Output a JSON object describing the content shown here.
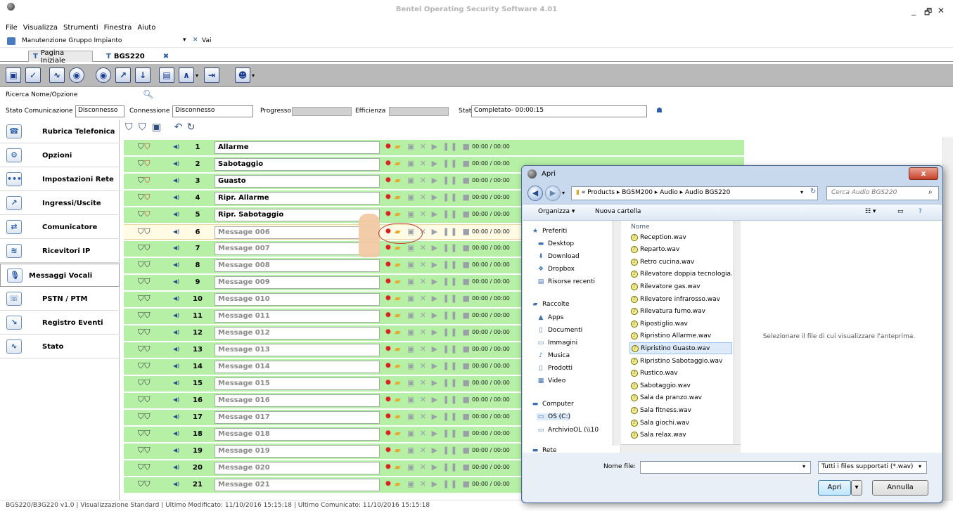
{
  "app": {
    "title": "Bentel Operating Security Software 4.01",
    "window_controls": {
      "minimize": "_",
      "restore": "🗗",
      "close": "✕"
    },
    "menu": [
      "File",
      "Visualizza",
      "Strumenti",
      "Finestra",
      "Aiuto"
    ],
    "address": {
      "label": "Manutenzione Gruppo Impianto",
      "go": "Vai"
    },
    "tabs": [
      {
        "label": "Pagina Iniziale"
      },
      {
        "label": "BGS220"
      }
    ],
    "search_label": "Ricerca Nome/Opzione",
    "status": {
      "comm_label": "Stato Comunicazione",
      "comm_value": "Disconnesso",
      "conn_label": "Connessione",
      "conn_value": "Disconnesso",
      "progress_label": "Progresso",
      "efficiency_label": "Efficienza",
      "state_label": "Stato",
      "state_value": "Completato- 00:00:15"
    }
  },
  "sidebar": [
    {
      "label": "Rubrica Telefonica",
      "icon": "phonebook-icon",
      "glyph": "☎"
    },
    {
      "label": "Opzioni",
      "icon": "gears-icon",
      "glyph": "⚙"
    },
    {
      "label": "Impostazioni Rete",
      "icon": "network-dots-icon",
      "glyph": "•••"
    },
    {
      "label": "Ingressi/Uscite",
      "icon": "io-arrow-icon",
      "glyph": "↗"
    },
    {
      "label": "Comunicatore",
      "icon": "communicator-icon",
      "glyph": "⇄"
    },
    {
      "label": "Ricevitori IP",
      "icon": "wifi-icon",
      "glyph": "≋"
    },
    {
      "label": "Messaggi Vocali",
      "icon": "microphone-icon",
      "glyph": "🎙"
    },
    {
      "label": "PSTN / PTM",
      "icon": "pstn-icon",
      "glyph": "☏"
    },
    {
      "label": "Registro Eventi",
      "icon": "event-log-icon",
      "glyph": "↘"
    },
    {
      "label": "Stato",
      "icon": "status-pulse-icon",
      "glyph": "∿"
    }
  ],
  "messages": [
    {
      "num": "1",
      "name": "Allarme",
      "recorded": true,
      "time": "00:00 / 00:00"
    },
    {
      "num": "2",
      "name": "Sabotaggio",
      "recorded": true,
      "time": "00:00 / 00:00"
    },
    {
      "num": "3",
      "name": "Guasto",
      "recorded": true,
      "time": "00:00 / 00:00"
    },
    {
      "num": "4",
      "name": "Ripr. Allarme",
      "recorded": true,
      "time": "00:00 / 00:00"
    },
    {
      "num": "5",
      "name": "Ripr. Sabotaggio",
      "recorded": true,
      "time": "00:00 / 00:00"
    },
    {
      "num": "6",
      "name": "Message 006",
      "recorded": false,
      "time": "00:00 / 00:00"
    },
    {
      "num": "7",
      "name": "Message 007",
      "recorded": false,
      "time": "00:00 / 00:00"
    },
    {
      "num": "8",
      "name": "Message 008",
      "recorded": false,
      "time": "00:00 / 00:00"
    },
    {
      "num": "9",
      "name": "Message 009",
      "recorded": false,
      "time": "00:00 / 00:00"
    },
    {
      "num": "10",
      "name": "Message 010",
      "recorded": false,
      "time": "00:00 / 00:00"
    },
    {
      "num": "11",
      "name": "Message 011",
      "recorded": false,
      "time": "00:00 / 00:00"
    },
    {
      "num": "12",
      "name": "Message 012",
      "recorded": false,
      "time": "00:00 / 00:00"
    },
    {
      "num": "13",
      "name": "Message 013",
      "recorded": false,
      "time": "00:00 / 00:00"
    },
    {
      "num": "14",
      "name": "Message 014",
      "recorded": false,
      "time": "00:00 / 00:00"
    },
    {
      "num": "15",
      "name": "Message 015",
      "recorded": false,
      "time": "00:00 / 00:00"
    },
    {
      "num": "16",
      "name": "Message 016",
      "recorded": false,
      "time": "00:00 / 00:00"
    },
    {
      "num": "17",
      "name": "Message 017",
      "recorded": false,
      "time": "00:00 / 00:00"
    },
    {
      "num": "18",
      "name": "Message 018",
      "recorded": false,
      "time": "00:00 / 00:00"
    },
    {
      "num": "19",
      "name": "Message 019",
      "recorded": false,
      "time": "00:00 / 00:00"
    },
    {
      "num": "20",
      "name": "Message 020",
      "recorded": false,
      "time": "00:00 / 00:00"
    },
    {
      "num": "21",
      "name": "Message 021",
      "recorded": false,
      "time": "00:00 / 00:00"
    }
  ],
  "selected_row": "6",
  "footer": "BGS220/B3G220 v1.0  |  Visualizzazione Standard  |  Ultimo Modificato: 11/10/2016 15:15:18  |  Ultimo Comunicato: 11/10/2016 15:15:18",
  "dialog": {
    "title": "Apri",
    "close": "x",
    "path": "« Products ▸ BGSM200 ▸ Audio ▸ Audio BGS220",
    "search_placeholder": "Cerca Audio BGS220",
    "organize": "Organizza ▾",
    "new_folder": "Nuova cartella",
    "tree": [
      {
        "label": "Preferiti",
        "icon": "star-icon",
        "glyph": "★"
      },
      {
        "label": "Desktop",
        "icon": "desktop-icon",
        "glyph": "▬"
      },
      {
        "label": "Download",
        "icon": "download-folder-icon",
        "glyph": "⬇"
      },
      {
        "label": "Dropbox",
        "icon": "dropbox-icon",
        "glyph": "❖"
      },
      {
        "label": "Risorse recenti",
        "icon": "recent-icon",
        "glyph": "▤"
      },
      {
        "label": "Raccolte",
        "icon": "libraries-icon",
        "glyph": "▰"
      },
      {
        "label": "Apps",
        "icon": "apps-icon",
        "glyph": "▲"
      },
      {
        "label": "Documenti",
        "icon": "documents-icon",
        "glyph": "▯"
      },
      {
        "label": "Immagini",
        "icon": "pictures-icon",
        "glyph": "▭"
      },
      {
        "label": "Musica",
        "icon": "music-icon",
        "glyph": "♪"
      },
      {
        "label": "Prodotti",
        "icon": "products-icon",
        "glyph": "▯"
      },
      {
        "label": "Video",
        "icon": "video-icon",
        "glyph": "▦"
      },
      {
        "label": "Computer",
        "icon": "computer-icon",
        "glyph": "▬"
      },
      {
        "label": "OS (C:)",
        "icon": "drive-icon",
        "glyph": "▭"
      },
      {
        "label": "ArchivioOL (\\\\10",
        "icon": "network-drive-icon",
        "glyph": "▭"
      },
      {
        "label": "Rete",
        "icon": "network-icon",
        "glyph": "▬"
      }
    ],
    "column_header": "Nome",
    "files": [
      "Reception.wav",
      "Reparto.wav",
      "Retro cucina.wav",
      "Rilevatore doppia tecnologia.wav",
      "Rilevatore gas.wav",
      "Rilevatore infrarosso.wav",
      "Rilevatura fumo.wav",
      "Ripostiglio.wav",
      "Ripristino Allarme.wav",
      "Ripristino Guasto.wav",
      "Ripristino Sabotaggio.wav",
      "Rustico.wav",
      "Sabotaggio.wav",
      "Sala da pranzo.wav",
      "Sala fitness.wav",
      "Sala giochi.wav",
      "Sala relax.wav"
    ],
    "highlighted_file": "Ripristino Guasto.wav",
    "preview_text": "Selezionare il file di cui visualizzare l'anteprima.",
    "filename_label": "Nome file:",
    "filename_value": "",
    "filter": "Tutti i files supportati (*.wav)",
    "open_button": "Apri",
    "cancel_button": "Annulla"
  }
}
